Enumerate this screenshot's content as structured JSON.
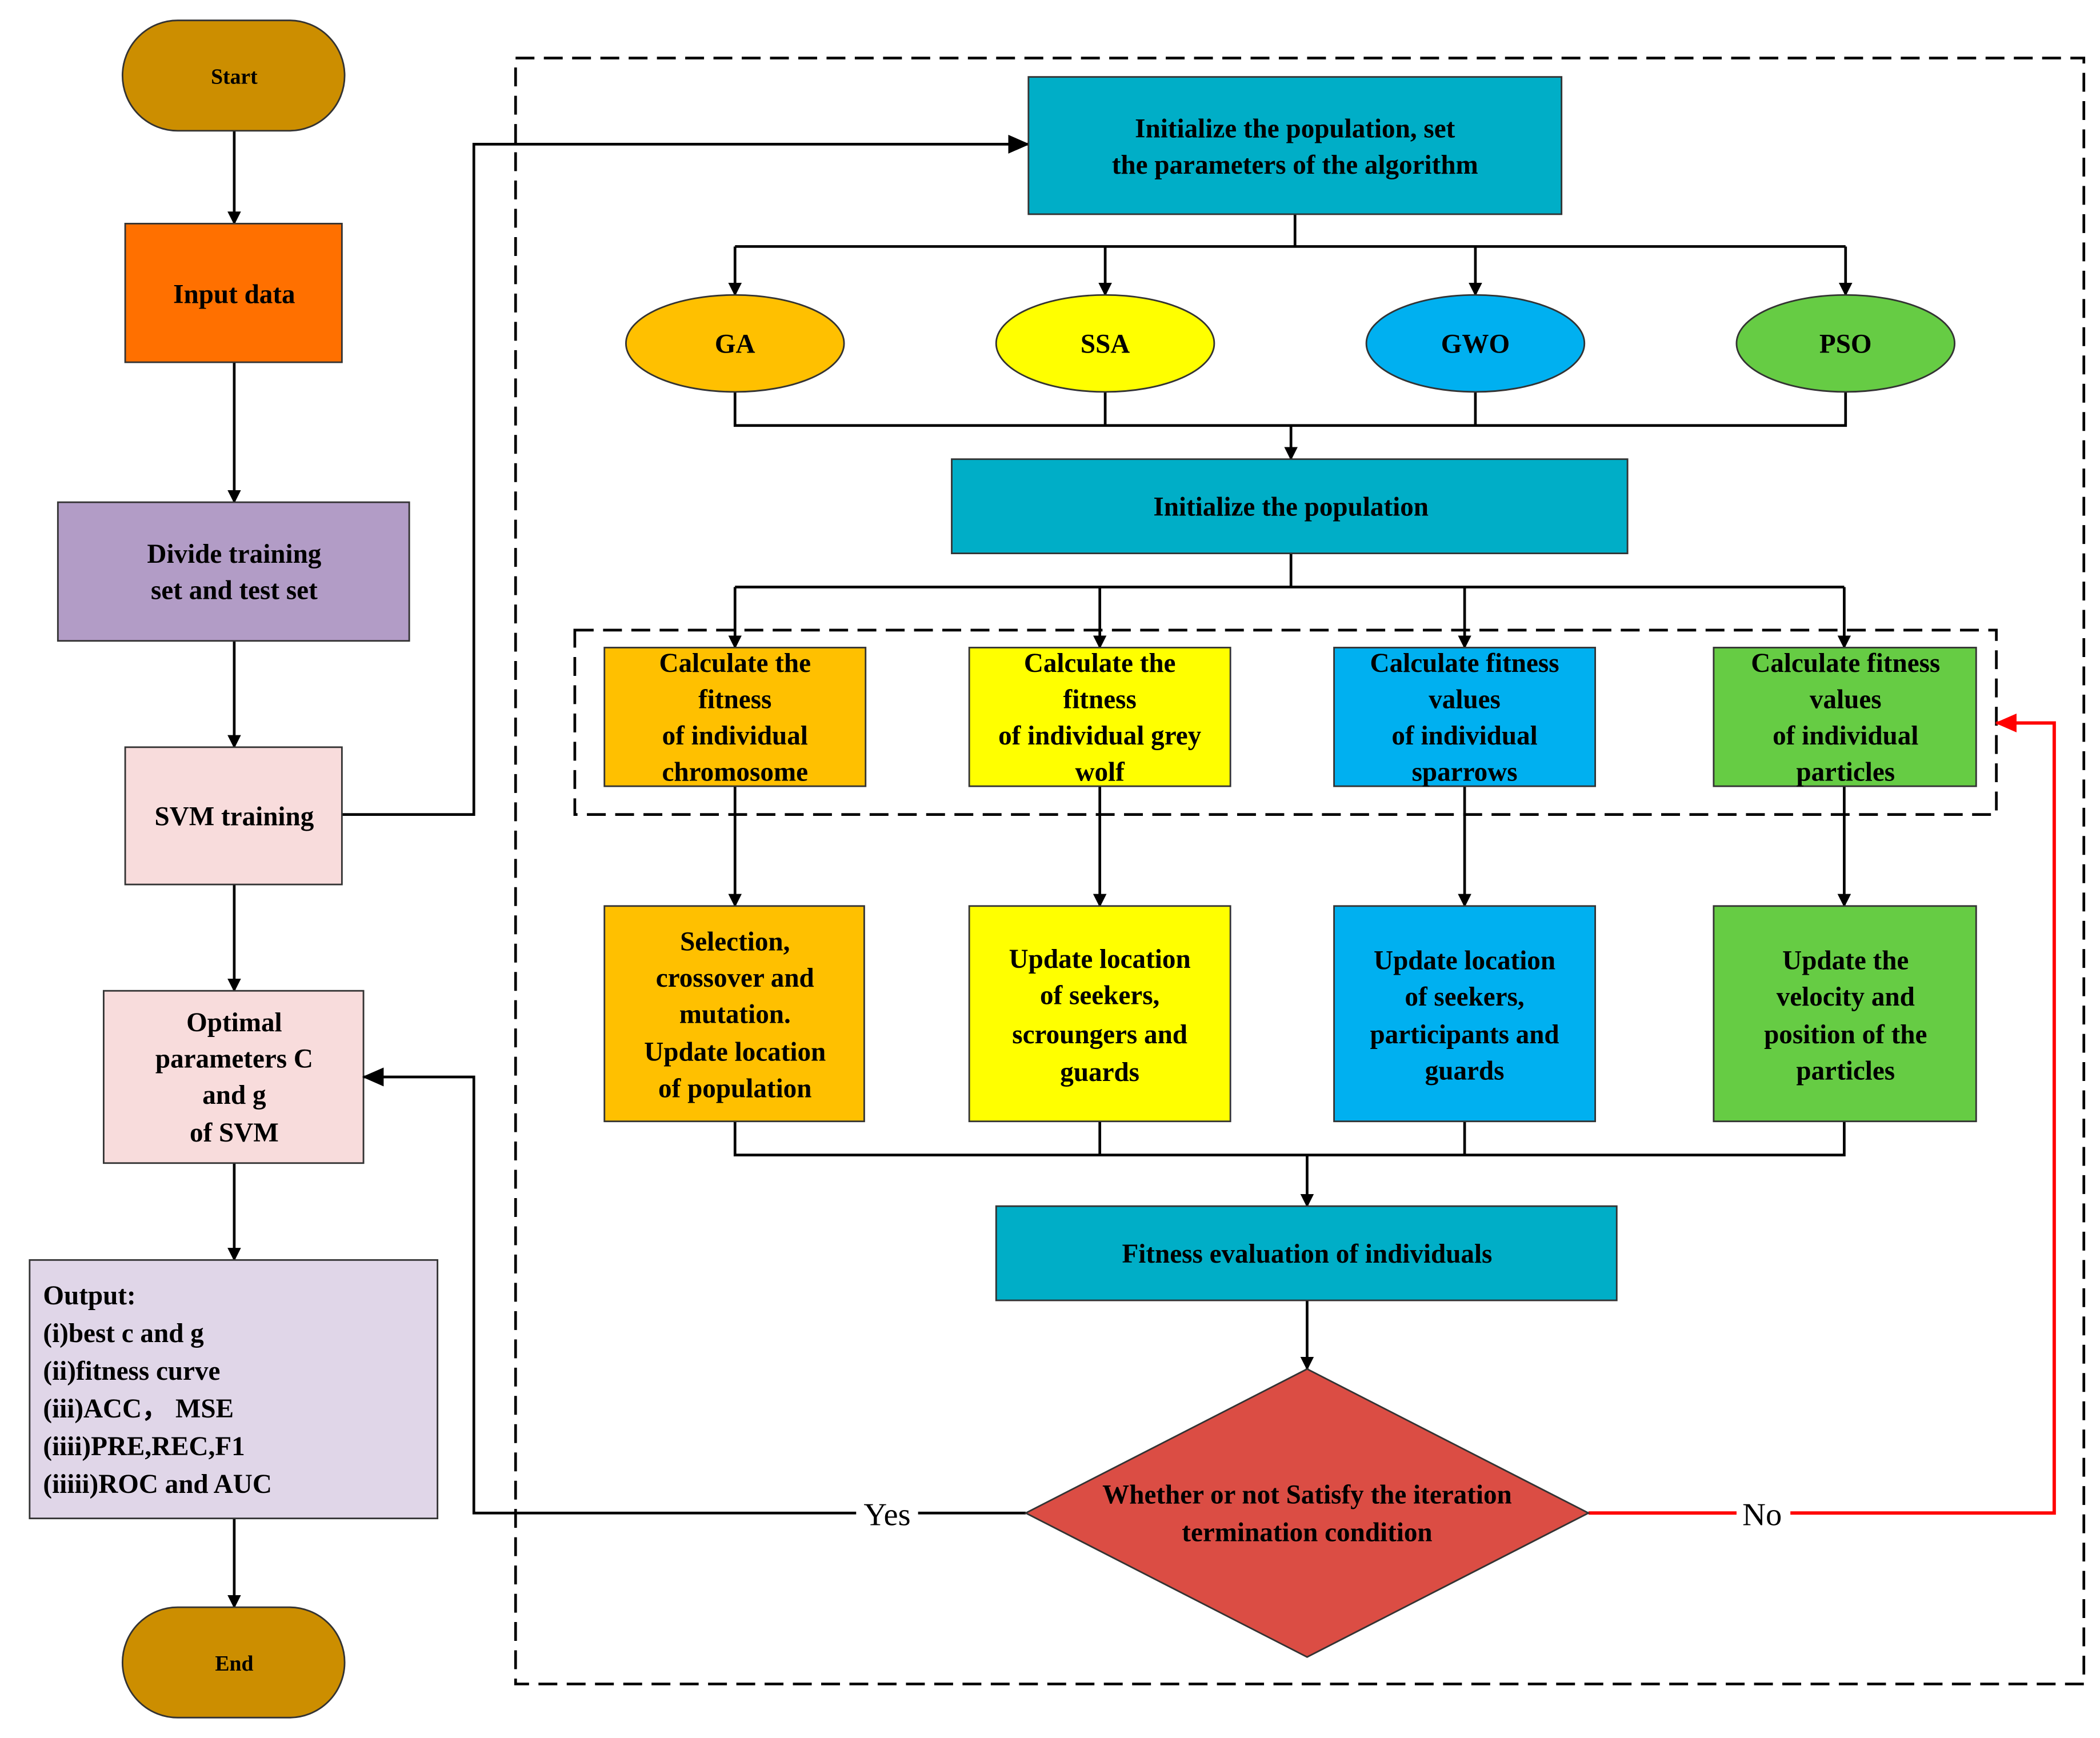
{
  "left": {
    "start": "Start",
    "input": "Input data",
    "divide": [
      "Divide training",
      "set and test set"
    ],
    "svm": "SVM training",
    "optimal": [
      "Optimal",
      "parameters C",
      "and g",
      "of SVM"
    ],
    "output": [
      "Output:",
      "(i)best c and g",
      "(ii)fitness curve",
      "(iii)ACC， MSE",
      "(iiii)PRE,REC,F1",
      "(iiiii)ROC and AUC"
    ],
    "end": "End"
  },
  "main": {
    "init_params": [
      "Initialize the population, set",
      "the parameters of the algorithm"
    ],
    "algorithms": [
      "GA",
      "SSA",
      "GWO",
      "PSO"
    ],
    "init_population": "Initialize the population",
    "calc": [
      [
        "Calculate the",
        "fitness",
        "of individual",
        "chromosome"
      ],
      [
        "Calculate the",
        "fitness",
        "of individual grey",
        "wolf"
      ],
      [
        "Calculate fitness",
        "values",
        "of individual",
        "sparrows"
      ],
      [
        "Calculate fitness",
        "values",
        "of individual",
        "particles"
      ]
    ],
    "update": [
      [
        "Selection,",
        "crossover and",
        "mutation.",
        "Update location",
        "of population"
      ],
      [
        "Update location",
        "of seekers,",
        "scroungers and",
        "guards"
      ],
      [
        "Update location",
        "of seekers,",
        "participants and",
        "guards"
      ],
      [
        "Update the",
        "velocity and",
        "position of the",
        "particles"
      ]
    ],
    "fitness_eval": "Fitness evaluation of individuals",
    "decision": [
      "Whether or not Satisfy the iteration",
      "termination condition"
    ],
    "yes": "Yes",
    "no": "No"
  },
  "colors": {
    "start_end": "#CC8E00",
    "input": "#FF7000",
    "divide": "#B29CC6",
    "svm": "#F8DCDC",
    "output": "#E0D6E8",
    "teal": "#00AEC7",
    "ga": "#FFC000",
    "ssa": "#FFFF00",
    "gwo": "#00B0F0",
    "pso": "#66CC44",
    "decision": "#DB4D44",
    "no_arrow": "#FF0000"
  }
}
